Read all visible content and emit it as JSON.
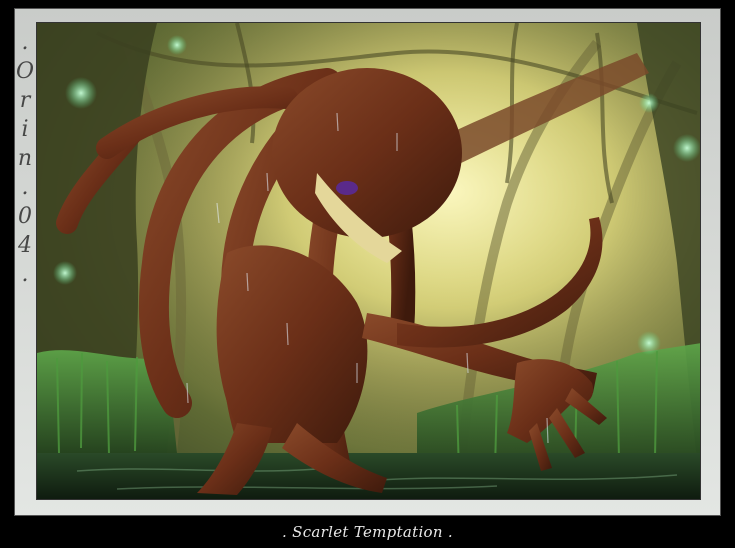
{
  "artwork": {
    "caption": ". Scarlet Temptation .",
    "signature_chars": [
      ".",
      "O",
      "r",
      "i",
      "n",
      ".",
      "0",
      "4",
      "."
    ]
  },
  "colors": {
    "frame": "#000000",
    "mat": "#d6d9d6",
    "glow": "#f3f0a8",
    "moss": "#3f8a3a",
    "body": "#6b2f18",
    "eye": "#5a2a8a"
  }
}
